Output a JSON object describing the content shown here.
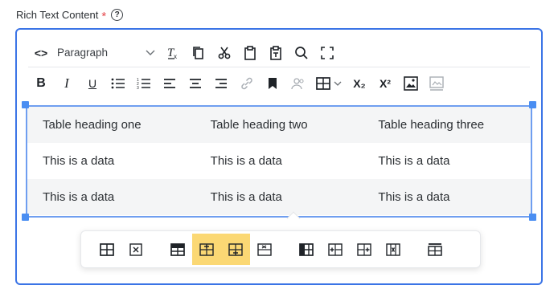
{
  "field": {
    "label": "Rich Text Content",
    "required_mark": "*",
    "help_glyph": "?"
  },
  "toolbar": {
    "block_format": "Paragraph",
    "row1": [
      "source-code",
      "block-format",
      "clear-formatting",
      "copy",
      "cut",
      "paste",
      "paste-as-text",
      "find-replace",
      "fullscreen"
    ],
    "row2": [
      "bold",
      "italic",
      "underline",
      "bullet-list",
      "numbered-list",
      "align-left",
      "align-center",
      "align-right",
      "link",
      "bookmark",
      "mention",
      "table",
      "subscript",
      "superscript",
      "image",
      "media"
    ],
    "bold_label": "B",
    "italic_label": "I",
    "underline_label": "U",
    "subscript_label": "X₂",
    "superscript_label": "X²",
    "source_label": "<>",
    "clear_label": "T"
  },
  "table": {
    "headers": [
      "Table heading one",
      "Table heading two",
      "Table heading three"
    ],
    "rows": [
      [
        "This is a data",
        "This is a data",
        "This is a data"
      ],
      [
        "This is a data",
        "This is a data",
        "This is a data"
      ]
    ]
  },
  "table_toolbar": {
    "groups": [
      [
        "table-properties",
        "delete-table"
      ],
      [
        "row-properties",
        "insert-row-before",
        "insert-row-after",
        "delete-row"
      ],
      [
        "column-properties",
        "insert-column-before",
        "insert-column-after",
        "delete-column"
      ],
      [
        "table-header"
      ]
    ],
    "active": [
      "insert-row-before",
      "insert-row-after"
    ],
    "accent_color": "#fbd874"
  },
  "colors": {
    "focus_border": "#3b74e6",
    "handle": "#4a8ef2",
    "required": "#e5484d"
  }
}
